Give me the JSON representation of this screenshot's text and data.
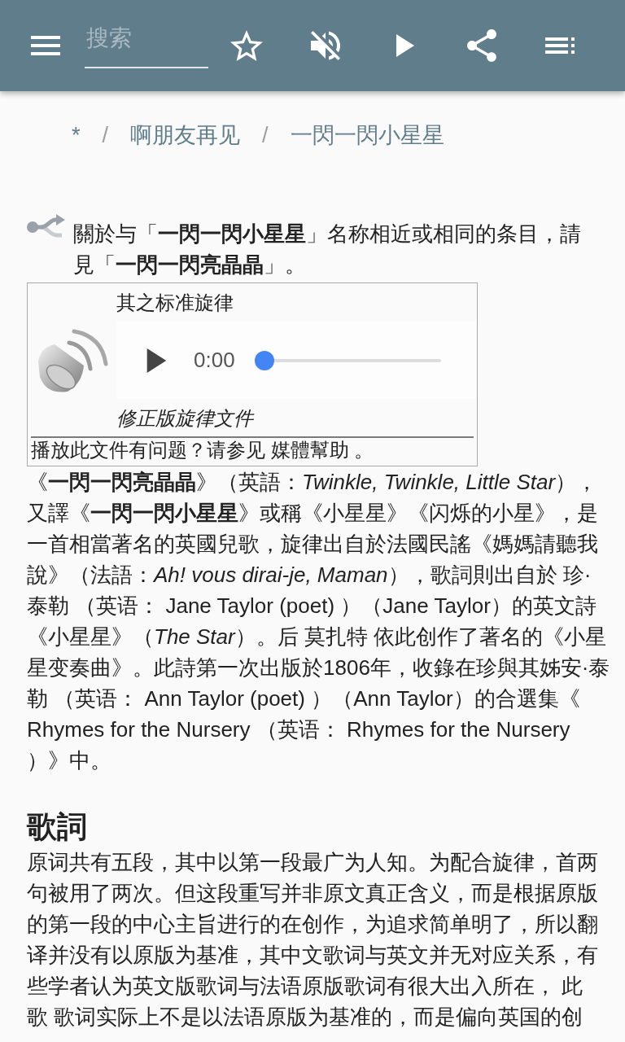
{
  "toolbar": {
    "search": {
      "placeholder": "搜索"
    }
  },
  "breadcrumb": [
    {
      "kind": "link",
      "text": "*"
    },
    {
      "kind": "separator",
      "text": "/"
    },
    {
      "kind": "link",
      "text": "啊朋友再见"
    },
    {
      "kind": "separator",
      "text": "/"
    },
    {
      "kind": "link",
      "text": "一閃一閃小星星"
    }
  ],
  "hatnote": {
    "text": "關於与「**一閃一閃小星星**」名称相近或相同的条目，請見「**一閃一閃亮晶晶**」。"
  },
  "audio": {
    "caption": "其之标准旋律",
    "time": "0:00",
    "level": 0,
    "description": "修正版旋律文件",
    "help": "播放此文件有问题？请参见 媒體幫助 。"
  },
  "intro": "《**一閃一閃亮晶晶**》（英語：*Twinkle, Twinkle, Little Star*），又譯《**一閃一閃小星星**》或稱《小星星》《闪烁的小星》，是一首相當著名的英國兒歌，旋律出自於法國民謠《媽媽請聽我說》（法語：*Ah! vous dirai-je, Maman*），歌詞則出自於 珍·泰勒 （英语： Jane Taylor (poet) ）（Jane Taylor）的英文詩《小星星》（*The Star*）。后 莫扎特 依此创作了著名的《小星星变奏曲》。此詩第一次出版於1806年，收錄在珍與其姊安·泰勒 （英语： Ann Taylor (poet) ）（Ann Taylor）的合選集《 Rhymes for the Nursery （英语： Rhymes for the Nursery ）》中。",
  "sections": [
    {
      "heading": "歌詞",
      "text": "原词共有五段，其中以第一段最广为人知。为配合旋律，首两句被用了两次。但这段重写并非原文真正含义，而是根据原版的第一段的中心主旨进行的在创作，为追求简单明了，所以翻译并没有以原版为基准，其中文歌词与英文并无对应关系，有些学者认为英文版歌词与法语原版歌词有很大出入所在， 此歌 歌词实际上不是以法语原版为基准的，而是偏向英国的创"
    }
  ]
}
